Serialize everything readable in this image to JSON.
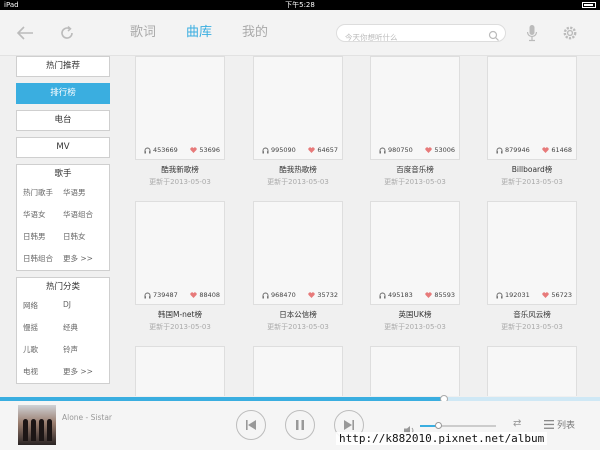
{
  "status_bar": {
    "carrier": "iPad",
    "time": "下午5:28"
  },
  "top_nav": {
    "tabs": [
      {
        "label": "歌词",
        "active": false
      },
      {
        "label": "曲库",
        "active": true
      },
      {
        "label": "我的",
        "active": false
      }
    ],
    "search_placeholder": "今天你想听什么",
    "icons": [
      "back-arrow-icon",
      "refresh-icon",
      "search-icon",
      "microphone-icon",
      "settings-gear-icon"
    ]
  },
  "sidebar": {
    "buttons": [
      {
        "label": "热门推荐",
        "active": false
      },
      {
        "label": "排行榜",
        "active": true
      },
      {
        "label": "电台",
        "active": false
      },
      {
        "label": "MV",
        "active": false
      }
    ],
    "singer_box": {
      "title": "歌手",
      "items": [
        "热门歌手",
        "华语男",
        "华语女",
        "华语组合",
        "日韩男",
        "日韩女",
        "日韩组合",
        "更多 >>"
      ]
    },
    "category_box": {
      "title": "热门分类",
      "items": [
        "网络",
        "DJ",
        "慢摇",
        "经典",
        "儿歌",
        "铃声",
        "电视",
        "更多 >>"
      ]
    }
  },
  "charts": [
    {
      "name": "酷我新歌榜",
      "updated": "更新于2013-05-03",
      "plays": "453669",
      "likes": "53696"
    },
    {
      "name": "酷我热歌榜",
      "updated": "更新于2013-05-03",
      "plays": "995090",
      "likes": "64657"
    },
    {
      "name": "百度音乐榜",
      "updated": "更新于2013-05-03",
      "plays": "980750",
      "likes": "53006"
    },
    {
      "name": "Billboard榜",
      "updated": "更新于2013-05-03",
      "plays": "879946",
      "likes": "61468"
    },
    {
      "name": "韩国M-net榜",
      "updated": "更新于2013-05-03",
      "plays": "739487",
      "likes": "88408"
    },
    {
      "name": "日本公信榜",
      "updated": "更新于2013-05-03",
      "plays": "968470",
      "likes": "35732"
    },
    {
      "name": "英国UK榜",
      "updated": "更新于2013-05-03",
      "plays": "495183",
      "likes": "85593"
    },
    {
      "name": "音乐风云榜",
      "updated": "更新于2013-05-03",
      "plays": "192031",
      "likes": "56723"
    },
    {
      "name": "",
      "updated": "",
      "plays": "",
      "likes": ""
    },
    {
      "name": "",
      "updated": "",
      "plays": "",
      "likes": ""
    },
    {
      "name": "",
      "updated": "",
      "plays": "",
      "likes": ""
    },
    {
      "name": "",
      "updated": "",
      "plays": "",
      "likes": ""
    }
  ],
  "player": {
    "track": "Alone - Sistar",
    "progress_fraction": 0.74,
    "volume_fraction": 0.24,
    "list_label": "列表"
  },
  "watermark": "http://k882010.pixnet.net/album",
  "colors": {
    "accent": "#3aaee0",
    "heart": "#e77a7a",
    "background": "#f0f0f0"
  }
}
